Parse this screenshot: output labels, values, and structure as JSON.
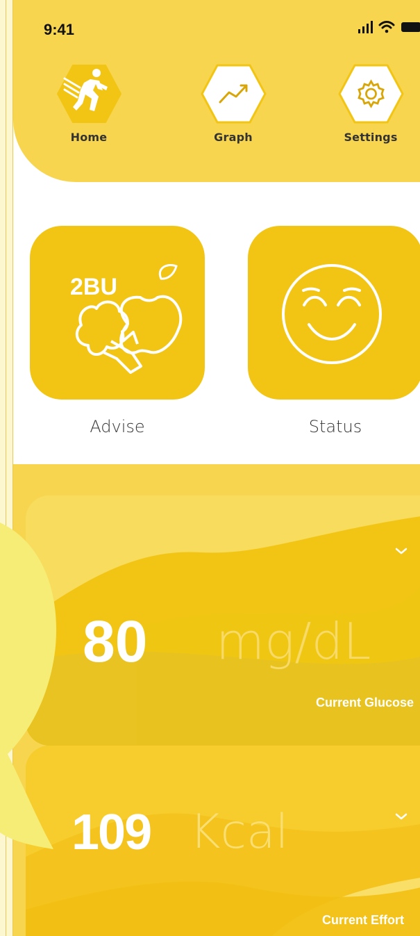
{
  "status_bar": {
    "time": "9:41",
    "icons": [
      "signal-icon",
      "wifi-icon",
      "battery-icon"
    ]
  },
  "nav": {
    "items": [
      {
        "label": "Home",
        "icon": "runner-icon",
        "active": true
      },
      {
        "label": "Graph",
        "icon": "trend-up-icon",
        "active": false
      },
      {
        "label": "Settings",
        "icon": "gear-icon",
        "active": false
      }
    ]
  },
  "tiles": {
    "advise": {
      "label": "Advise",
      "icon_text": "2BU",
      "icon": "food-icon"
    },
    "status": {
      "label": "Status",
      "icon": "smiley-icon"
    }
  },
  "glucose": {
    "value": "80",
    "unit": "mg/dL",
    "caption": "Current Glucose"
  },
  "effort": {
    "value": "109",
    "unit": "Kcal",
    "caption": "Current Effort"
  },
  "colors": {
    "header": "#f7d54f",
    "tile": "#f2c515",
    "panel_light": "#f8dc5e",
    "panel_mid": "#f6cd2d",
    "text_dark": "#333333",
    "white": "#ffffff",
    "outer_background": "#fdf7cf",
    "bubble": "#f6ed76"
  }
}
